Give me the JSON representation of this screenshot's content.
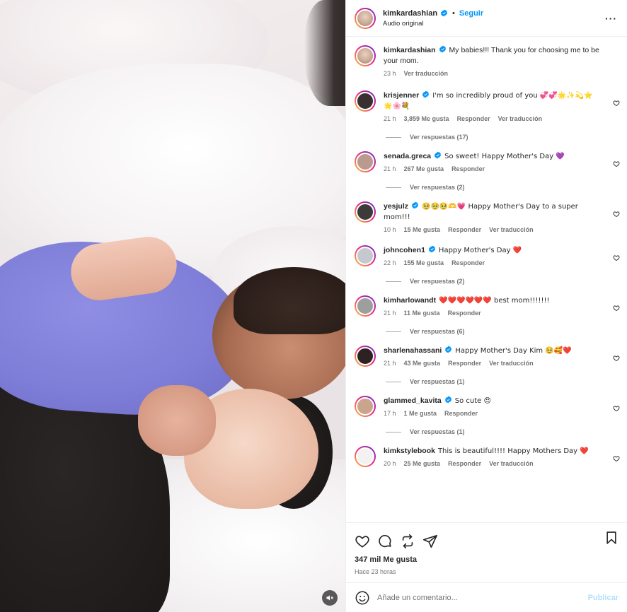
{
  "header": {
    "username": "kimkardashian",
    "separator": "•",
    "follow_label": "Seguir",
    "subtitle": "Audio original",
    "more_label": "···"
  },
  "caption": {
    "username": "kimkardashian",
    "text": "My babies!!! Thank you for choosing me to be your mom.",
    "time": "23 h",
    "translate": "Ver traducción"
  },
  "comments": [
    {
      "username": "krisjenner",
      "verified": true,
      "text": "I'm so incredibly proud of you 💞💞🌟✨💫⭐ 🌟🌸💐",
      "time": "21 h",
      "likes": "3,859 Me gusta",
      "reply": "Responder",
      "translate": "Ver traducción",
      "replies": "Ver respuestas (17)",
      "avatar_color": "#3a3030"
    },
    {
      "username": "senada.greca",
      "verified": true,
      "text": "So sweet! Happy Mother's Day 💜",
      "time": "21 h",
      "likes": "267 Me gusta",
      "reply": "Responder",
      "translate": "",
      "replies": "Ver respuestas (2)",
      "avatar_color": "#b99a8c"
    },
    {
      "username": "yesjulz",
      "verified": true,
      "text": "🥹🥹🥹🫶💗 Happy Mother's Day to a super mom!!!",
      "time": "10 h",
      "likes": "15 Me gusta",
      "reply": "Responder",
      "translate": "Ver traducción",
      "replies": "",
      "avatar_color": "#3d3a3a"
    },
    {
      "username": "johncohen1",
      "verified": true,
      "text": "Happy Mother's Day ❤️",
      "time": "22 h",
      "likes": "155 Me gusta",
      "reply": "Responder",
      "translate": "",
      "replies": "Ver respuestas (2)",
      "avatar_color": "#c5c8cf"
    },
    {
      "username": "kimharlowandt",
      "verified": false,
      "text": "❤️❤️❤️❤️❤️❤️ best mom!!!!!!!",
      "time": "21 h",
      "likes": "11 Me gusta",
      "reply": "Responder",
      "translate": "",
      "replies": "Ver respuestas (6)",
      "avatar_color": "#9e9e9e"
    },
    {
      "username": "sharlenahassani",
      "verified": true,
      "text": "Happy Mother's Day Kim 🥹🥰❤️",
      "time": "21 h",
      "likes": "43 Me gusta",
      "reply": "Responder",
      "translate": "Ver traducción",
      "replies": "Ver respuestas (1)",
      "avatar_color": "#2c2222"
    },
    {
      "username": "glammed_kavita",
      "verified": true,
      "text": "So cute 😍",
      "time": "17 h",
      "likes": "1 Me gusta",
      "reply": "Responder",
      "translate": "",
      "replies": "Ver respuestas (1)",
      "avatar_color": "#caa48c"
    },
    {
      "username": "kimkstylebook",
      "verified": false,
      "text": "This is beautiful!!!! Happy Mothers Day ❤️",
      "time": "20 h",
      "likes": "25 Me gusta",
      "reply": "Responder",
      "translate": "Ver traducción",
      "replies": "",
      "avatar_color": "#f4f1f1"
    }
  ],
  "actions": {
    "likes": "347 mil Me gusta",
    "time": "Hace 23 horas"
  },
  "composer": {
    "placeholder": "Añade un comentario...",
    "publish": "Publicar"
  },
  "colors": {
    "accent": "#0095f6",
    "publish_disabled": "#b2dffc",
    "muted_text": "#737373"
  },
  "icons": [
    "verified-badge-icon",
    "heart-icon",
    "comment-icon",
    "share-icon",
    "send-icon",
    "bookmark-icon",
    "smile-icon",
    "mute-icon",
    "more-icon"
  ]
}
